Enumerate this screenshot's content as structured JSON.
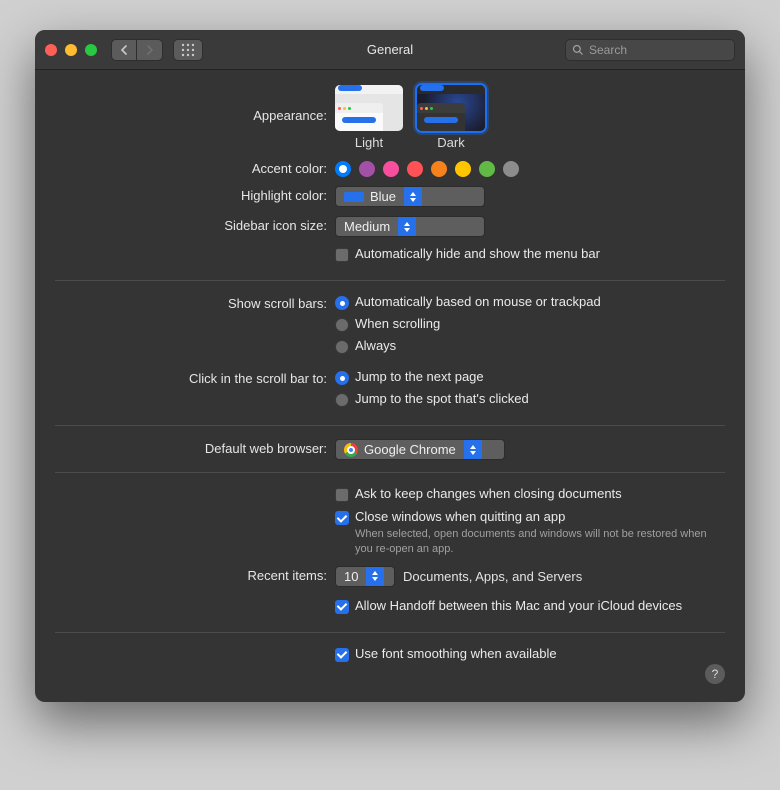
{
  "window": {
    "title": "General"
  },
  "search": {
    "placeholder": "Search"
  },
  "appearance": {
    "label": "Appearance:",
    "options": {
      "light": "Light",
      "dark": "Dark"
    },
    "selected": "dark"
  },
  "accent": {
    "label": "Accent color:",
    "colors": [
      "#007aff",
      "#a550a7",
      "#f74f9e",
      "#ff5257",
      "#f7821b",
      "#ffc600",
      "#62ba46",
      "#8c8c8c"
    ],
    "selected_index": 0
  },
  "highlight": {
    "label": "Highlight color:",
    "value": "Blue",
    "color": "#2670ec"
  },
  "sidebar_icon": {
    "label": "Sidebar icon size:",
    "value": "Medium"
  },
  "auto_hide_menubar": {
    "label": "Automatically hide and show the menu bar",
    "checked": false
  },
  "scroll_bars": {
    "label": "Show scroll bars:",
    "options": [
      "Automatically based on mouse or trackpad",
      "When scrolling",
      "Always"
    ],
    "selected_index": 0
  },
  "click_scrollbar": {
    "label": "Click in the scroll bar to:",
    "options": [
      "Jump to the next page",
      "Jump to the spot that's clicked"
    ],
    "selected_index": 0
  },
  "browser": {
    "label": "Default web browser:",
    "value": "Google Chrome"
  },
  "ask_keep_changes": {
    "label": "Ask to keep changes when closing documents",
    "checked": false
  },
  "close_windows": {
    "label": "Close windows when quitting an app",
    "checked": true,
    "hint": "When selected, open documents and windows will not be restored when you re-open an app."
  },
  "recent_items": {
    "label": "Recent items:",
    "value": "10",
    "suffix": "Documents, Apps, and Servers"
  },
  "handoff": {
    "label": "Allow Handoff between this Mac and your iCloud devices",
    "checked": true
  },
  "font_smoothing": {
    "label": "Use font smoothing when available",
    "checked": true
  },
  "help_glyph": "?"
}
